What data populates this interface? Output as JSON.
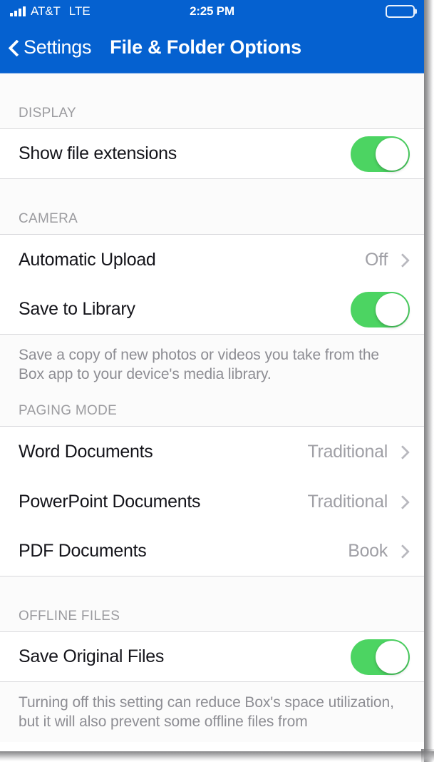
{
  "status_bar": {
    "signal_icon": "signal-bars-icon",
    "signal_bars": 4,
    "carrier": "AT&T",
    "network": "LTE",
    "time": "2:25 PM",
    "battery_icon": "battery-full-icon",
    "battery_level_percent": 100
  },
  "nav_bar": {
    "back_icon": "chevron-left-icon",
    "back_label": "Settings",
    "title": "File & Folder Options",
    "background_color": "#0561D0"
  },
  "colors": {
    "accent_blue": "#0561D0",
    "toggle_on_green": "#4CD462",
    "section_header_gray": "#9b9b9f",
    "value_gray": "#a0a0a6",
    "separator": "#d9d9dc",
    "group_background": "#fbfbfb"
  },
  "sections": [
    {
      "header": "DISPLAY",
      "rows": [
        {
          "label": "Show file extensions",
          "control": "toggle",
          "state": "on"
        }
      ],
      "footer": null
    },
    {
      "header": "CAMERA",
      "rows": [
        {
          "label": "Automatic Upload",
          "control": "disclosure",
          "value": "Off",
          "chevron_icon": "chevron-right-icon"
        },
        {
          "label": "Save to Library",
          "control": "toggle",
          "state": "on"
        }
      ],
      "footer": "Save a copy of new photos or videos you take from the Box app to your device's media library."
    },
    {
      "header": "PAGING MODE",
      "rows": [
        {
          "label": "Word Documents",
          "control": "disclosure",
          "value": "Traditional",
          "chevron_icon": "chevron-right-icon"
        },
        {
          "label": "PowerPoint Documents",
          "control": "disclosure",
          "value": "Traditional",
          "chevron_icon": "chevron-right-icon"
        },
        {
          "label": "PDF Documents",
          "control": "disclosure",
          "value": "Book",
          "chevron_icon": "chevron-right-icon"
        }
      ],
      "footer": null
    },
    {
      "header": "OFFLINE FILES",
      "rows": [
        {
          "label": "Save Original Files",
          "control": "toggle",
          "state": "on"
        }
      ],
      "footer": "Turning off this setting can reduce Box's space utilization, but it will also prevent some offline files from"
    }
  ]
}
